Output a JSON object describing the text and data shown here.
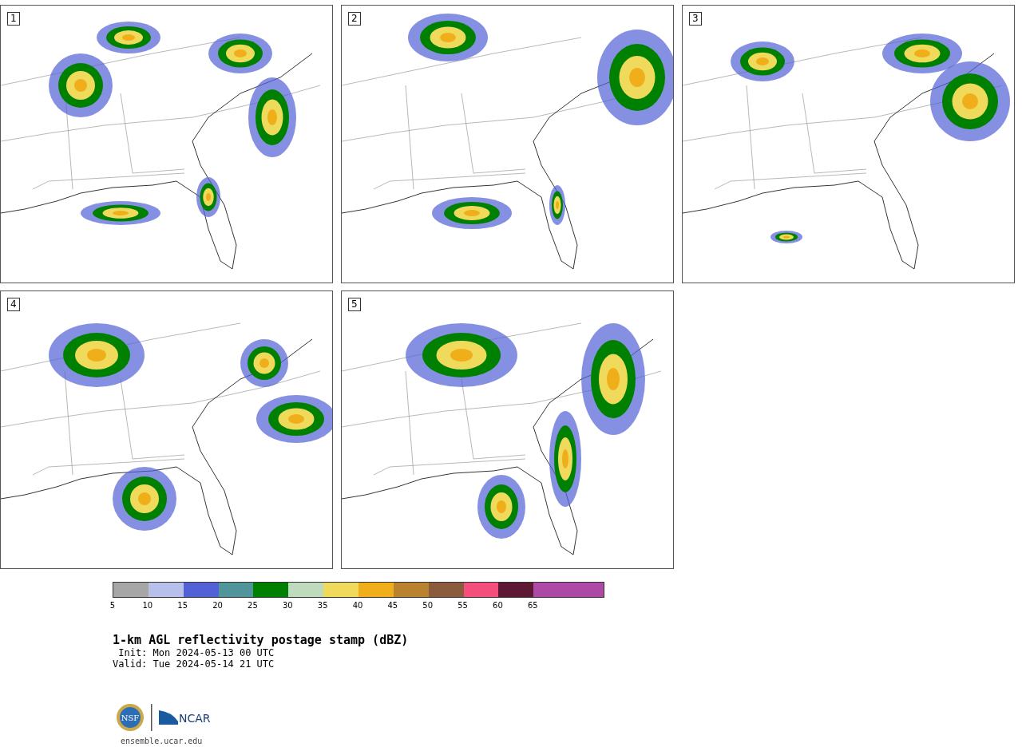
{
  "panels": [
    {
      "number": "1"
    },
    {
      "number": "2"
    },
    {
      "number": "3"
    },
    {
      "number": "4"
    },
    {
      "number": "5"
    }
  ],
  "colorbar": {
    "segments": [
      {
        "color": "#a6a6a6",
        "tick": "5"
      },
      {
        "color": "#b7c0eb",
        "tick": "10"
      },
      {
        "color": "#5261d6",
        "tick": "15"
      },
      {
        "color": "#4f9599",
        "tick": "20"
      },
      {
        "color": "#008000",
        "tick": "25"
      },
      {
        "color": "#bedcbd",
        "tick": "30"
      },
      {
        "color": "#f0da5c",
        "tick": "35"
      },
      {
        "color": "#f0af1a",
        "tick": "40"
      },
      {
        "color": "#b8822f",
        "tick": "45"
      },
      {
        "color": "#8b5b3e",
        "tick": "50"
      },
      {
        "color": "#f44e7c",
        "tick": "55"
      },
      {
        "color": "#5f1833",
        "tick": "60"
      },
      {
        "color": "#ad4aa6",
        "tick": "65"
      },
      {
        "color": "#ad4aa6"
      }
    ]
  },
  "title": "1-km AGL reflectivity postage stamp (dBZ)",
  "init": "Init: Mon 2024-05-13 00 UTC",
  "valid": "Valid: Tue 2024-05-14 21 UTC",
  "logo": {
    "nsf": "NSF",
    "ncar": "NCAR"
  },
  "url": "ensemble.ucar.edu"
}
